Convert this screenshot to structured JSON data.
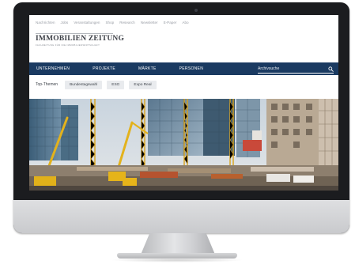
{
  "top_nav": [
    "Nachrichten",
    "Jobs",
    "Veranstaltungen",
    "Shop",
    "Research",
    "Newsletter",
    "E-Paper",
    "Abo"
  ],
  "logo": {
    "word": "IMMOBILIEN ZEITUNG",
    "tagline": "FACHZEITUNG FÜR DIE IMMOBILIENWIRTSCHAFT"
  },
  "main_nav": [
    "UNTERNEHMEN",
    "PROJEKTE",
    "MÄRKTE",
    "PERSONEN"
  ],
  "search": {
    "placeholder": "Archivsuche"
  },
  "topics": {
    "label": "Top-Themen",
    "chips": [
      "Bundestagswahl",
      "ESG",
      "Expo Real"
    ]
  },
  "hero": {
    "icon": "construction-site-photo"
  },
  "colors": {
    "nav_bg": "#1a3a61",
    "chip_bg": "#e9ebee",
    "bezel": "#1b1c1f",
    "chin": "#d4d5d8"
  }
}
